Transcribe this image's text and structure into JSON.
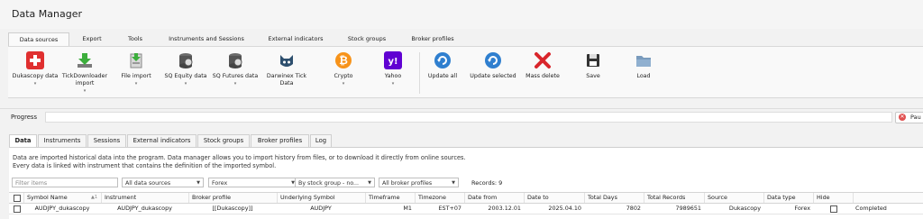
{
  "window": {
    "title": "Data Manager"
  },
  "ribbon_tabs": [
    "Data sources",
    "Export",
    "Tools",
    "Instruments and Sessions",
    "External indicators",
    "Stock groups",
    "Broker profiles"
  ],
  "ribbon_buttons": [
    {
      "label": "Dukascopy data",
      "icon": "dukascopy-icon",
      "caret": "▾"
    },
    {
      "label": "TickDownloader import",
      "icon": "tickdownloader-icon",
      "caret": "▾"
    },
    {
      "label": "File import",
      "icon": "file-import-icon",
      "caret": "▾"
    },
    {
      "label": "SQ Equity data",
      "icon": "database-icon",
      "caret": "▾"
    },
    {
      "label": "SQ Futures data",
      "icon": "database-icon",
      "caret": "▾"
    },
    {
      "label": "Darwinex Tick Data",
      "icon": "darwinex-icon",
      "caret": ""
    },
    {
      "label": "Crypto",
      "icon": "bitcoin-icon",
      "caret": "▾"
    },
    {
      "label": "Yahoo",
      "icon": "yahoo-icon",
      "caret": "▾"
    },
    {
      "label": "Update all",
      "icon": "refresh-icon",
      "caret": ""
    },
    {
      "label": "Update selected",
      "icon": "refresh-icon",
      "caret": ""
    },
    {
      "label": "Mass delete",
      "icon": "delete-x-icon",
      "caret": ""
    },
    {
      "label": "Save",
      "icon": "floppy-icon",
      "caret": ""
    },
    {
      "label": "Load",
      "icon": "folder-icon",
      "caret": ""
    }
  ],
  "progress": {
    "label": "Progress",
    "pause_label": "Pau"
  },
  "sub_tabs": [
    "Data",
    "Instruments",
    "Sessions",
    "External indicators",
    "Stock groups",
    "Broker profiles",
    "Log"
  ],
  "description": {
    "line1": "Data are imported historical data into the program. Data manager allows you to import history from files, or to download it directly from online sources.",
    "line2": "Every data is linked with instrument that contains the definition of the imported symbol."
  },
  "filters": {
    "search_placeholder": "Filter items",
    "data_sources": "All data sources",
    "category": "Forex",
    "stock_group": "By stock group - no...",
    "broker_profiles": "All broker profiles"
  },
  "records_label": "Records: 9",
  "table": {
    "columns": [
      "Symbol Name",
      "Instrument",
      "Broker profile",
      "Underlying Symbol",
      "Timeframe",
      "Timezone",
      "Date from",
      "Date to",
      "Total Days",
      "Total Records",
      "Source",
      "Data type",
      "Hide",
      ""
    ],
    "sort_indicator": "▲1",
    "rows": [
      [
        "AUDJPY_dukascopy",
        "AUDJPY_dukascopy",
        "[[Dukascopy]]",
        "AUDJPY",
        "M1",
        "EST+07",
        "2003.12.01",
        "2025.04.10",
        "7802",
        "7989651",
        "Dukascopy",
        "Forex",
        "",
        "Completed"
      ]
    ]
  }
}
